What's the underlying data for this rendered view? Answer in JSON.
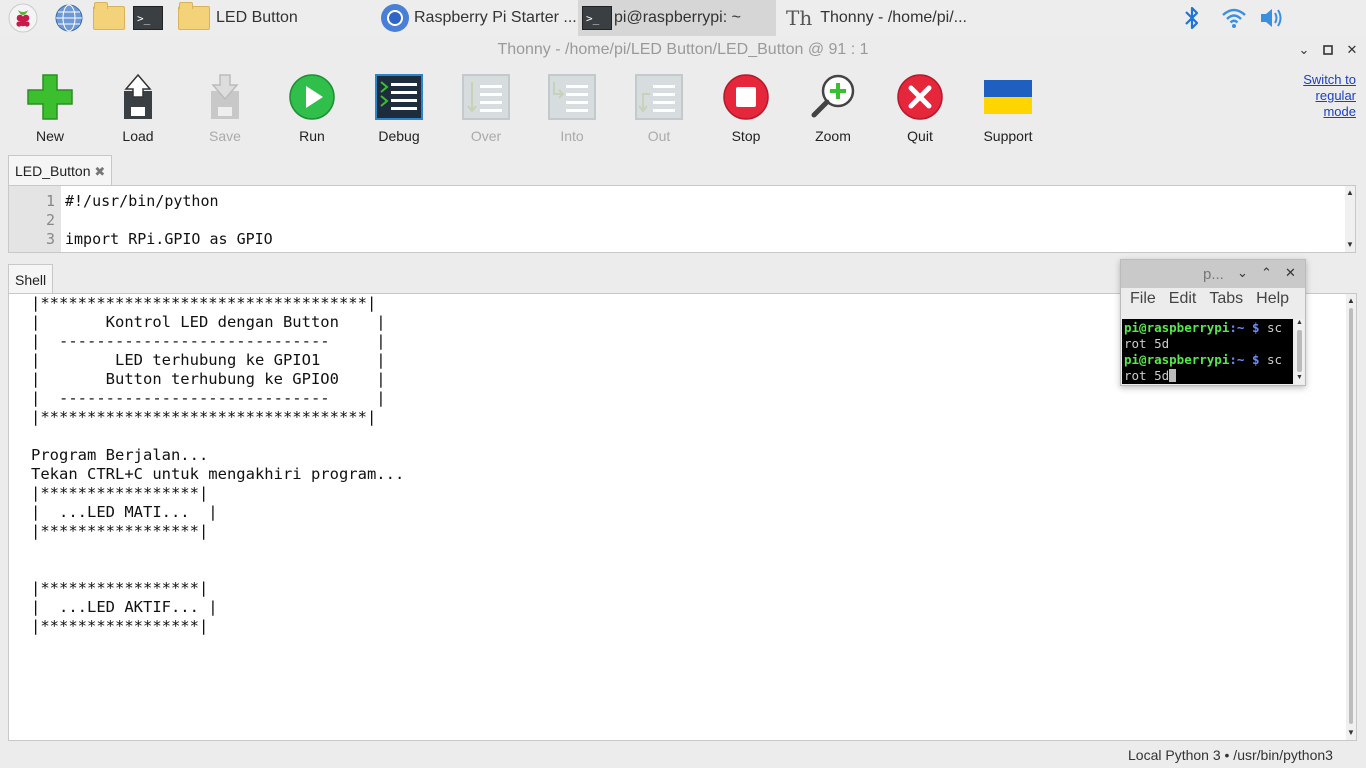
{
  "taskbar": {
    "tasks": [
      {
        "label": "LED Button"
      },
      {
        "label": "Raspberry Pi Starter ..."
      },
      {
        "label": "pi@raspberrypi: ~"
      },
      {
        "label": "Thonny  -  /home/pi/..."
      }
    ]
  },
  "window": {
    "title": "Thonny  -  /home/pi/LED Button/LED_Button  @  91 : 1"
  },
  "toolbar": {
    "new": "New",
    "load": "Load",
    "save": "Save",
    "run": "Run",
    "debug": "Debug",
    "over": "Over",
    "into": "Into",
    "out": "Out",
    "stop": "Stop",
    "zoom": "Zoom",
    "quit": "Quit",
    "support": "Support",
    "switch_mode": "Switch to regular mode"
  },
  "editor": {
    "tab_label": "LED_Button",
    "line_numbers": [
      "1",
      "2",
      "3"
    ],
    "lines": [
      "#!/usr/bin/python",
      "",
      "import RPi.GPIO as GPIO"
    ]
  },
  "shell": {
    "tab_label": "Shell",
    "output": "|***********************************|\n|       Kontrol LED dengan Button    |\n|  -----------------------------     |\n|        LED terhubung ke GPIO1      |\n|       Button terhubung ke GPIO0    |\n|  -----------------------------     |\n|***********************************|\n\nProgram Berjalan...\nTekan CTRL+C untuk mengakhiri program...\n|*****************|\n|  ...LED MATI...  |\n|*****************|\n\n\n|*****************|\n|  ...LED AKTIF... |\n|*****************|"
  },
  "status": {
    "text": "Local Python 3  •  /usr/bin/python3"
  },
  "terminal": {
    "title": "p...",
    "menu": [
      "File",
      "Edit",
      "Tabs",
      "Help"
    ],
    "prompt_user": "pi@raspberrypi",
    "prompt_path": ":~",
    "prompt_symbol": " $ ",
    "cmd_start": "sc",
    "cmd_rest": "rot 5d"
  },
  "colors": {
    "accent_green": "#3cbf2f",
    "run_green": "#2fbf4a",
    "stop_red": "#e5263b",
    "ukraine_blue": "#1f5fbf",
    "ukraine_yellow": "#ffd500",
    "link_blue": "#1a3fbf"
  }
}
